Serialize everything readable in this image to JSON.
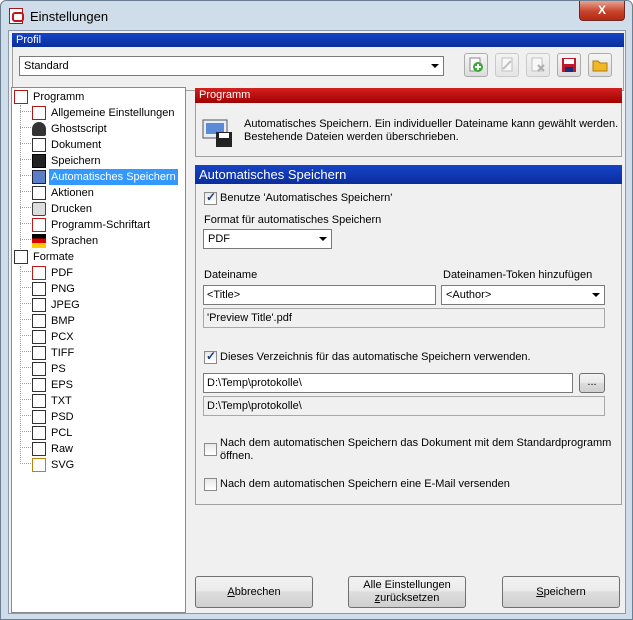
{
  "window": {
    "title": "Einstellungen",
    "close_label": "X"
  },
  "profile": {
    "header": "Profil",
    "selected": "Standard"
  },
  "tree": {
    "programm": "Programm",
    "programm_items": [
      "Allgemeine Einstellungen",
      "Ghostscript",
      "Dokument",
      "Speichern",
      "Automatisches Speichern",
      "Aktionen",
      "Drucken",
      "Programm-Schriftart",
      "Sprachen"
    ],
    "formate": "Formate",
    "format_items": [
      "PDF",
      "PNG",
      "JPEG",
      "BMP",
      "PCX",
      "TIFF",
      "PS",
      "EPS",
      "TXT",
      "PSD",
      "PCL",
      "Raw",
      "SVG"
    ]
  },
  "programm_section": {
    "header": "Programm",
    "description_line1": "Automatisches Speichern. Ein individueller Dateiname kann gewählt werden.",
    "description_line2": "Bestehende Dateien werden überschrieben."
  },
  "auto_save": {
    "header": "Automatisches Speichern",
    "use_autosave_label": "Benutze 'Automatisches Speichern'",
    "format_label": "Format für automatisches Speichern",
    "format_value": "PDF",
    "filename_label": "Dateiname",
    "filename_value": "<Title>",
    "token_label": "Dateinamen-Token hinzufügen",
    "token_value": "<Author>",
    "filename_preview": "'Preview Title'.pdf",
    "use_dir_label": "Dieses Verzeichnis für das automatische Speichern verwenden.",
    "dir_value": "D:\\Temp\\protokolle\\",
    "browse_label": "...",
    "dir_preview": "D:\\Temp\\protokolle\\",
    "open_after_line1": "Nach dem automatischen Speichern das Dokument mit dem Standardprogramm",
    "open_after_line2": "öffnen.",
    "email_after_label": "Nach dem automatischen Speichern eine E-Mail versenden"
  },
  "buttons": {
    "cancel_u": "A",
    "cancel_rest": "bbrechen",
    "reset_line1": "Alle Einstellungen",
    "reset_u": "z",
    "reset_rest": "urücksetzen",
    "save_u": "S",
    "save_rest": "peichern"
  },
  "icons": {
    "toolbar": [
      "add-profile-icon",
      "rename-profile-icon",
      "delete-profile-icon",
      "save-profile-icon",
      "open-profile-icon"
    ]
  },
  "colors": {
    "header_blue": "#0a2d9c",
    "header_red": "#a10000",
    "selection": "#3399ff"
  }
}
